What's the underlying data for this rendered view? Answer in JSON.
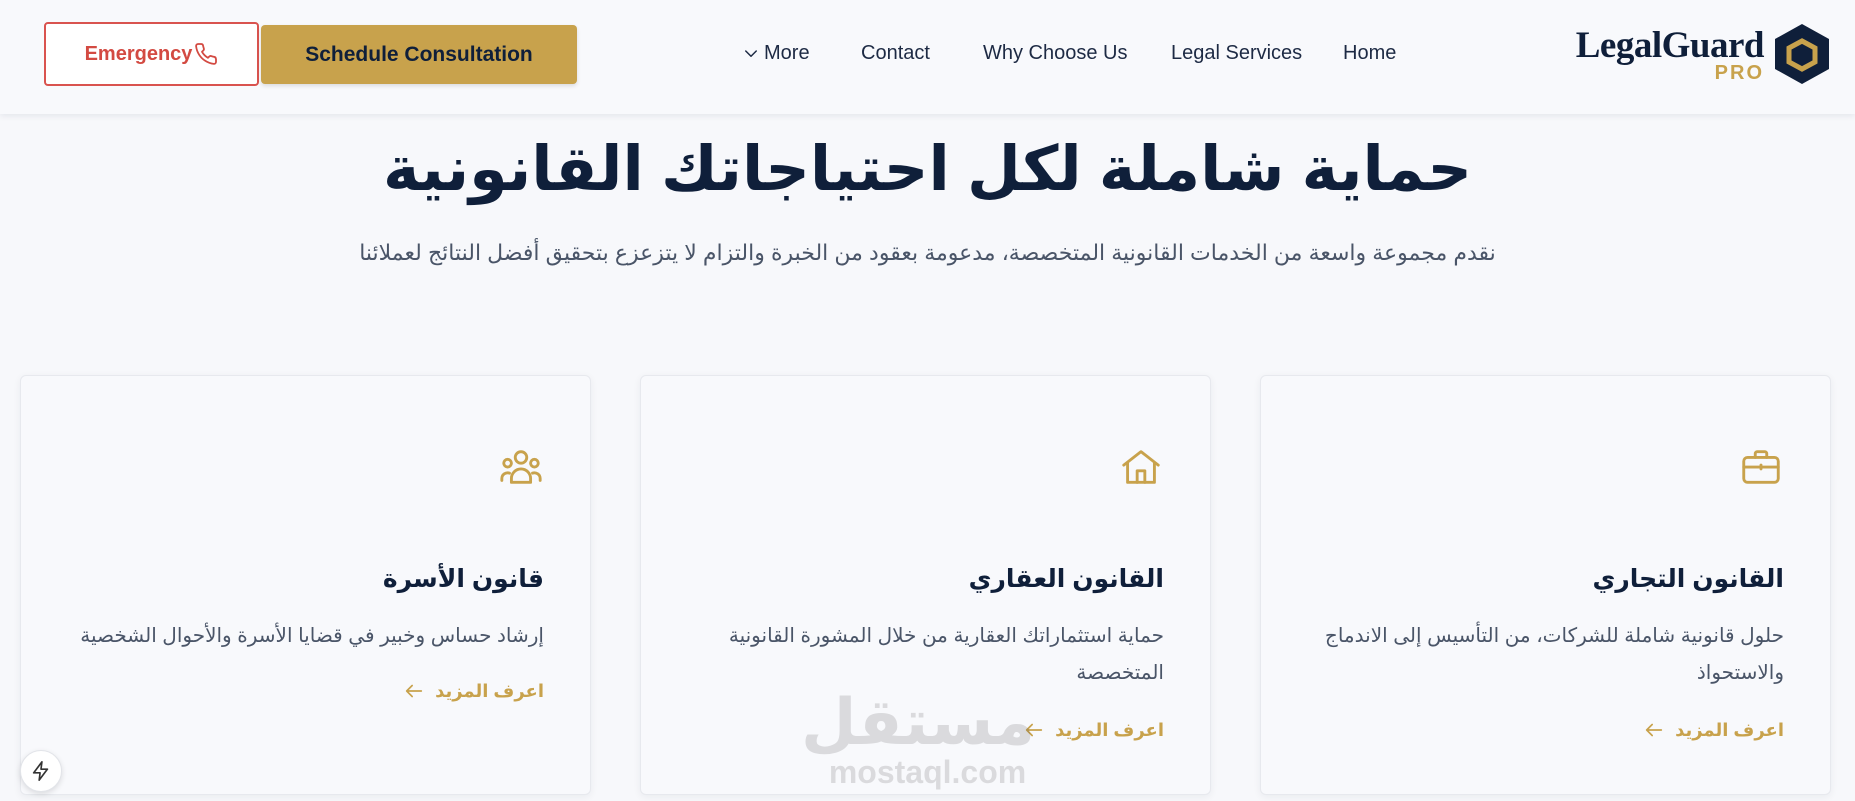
{
  "header": {
    "emergency_label": "Emergency",
    "schedule_label": "Schedule Consultation",
    "nav": {
      "more": "More",
      "contact": "Contact",
      "why": "Why Choose Us",
      "services": "Legal Services",
      "home": "Home"
    },
    "logo": {
      "name": "LegalGuard",
      "sub": "PRO"
    }
  },
  "hero": {
    "title": "حماية شاملة لكل احتياجاتك القانونية",
    "subtitle": "نقدم مجموعة واسعة من الخدمات القانونية المتخصصة، مدعومة بعقود من الخبرة والتزام لا يتزعزع بتحقيق أفضل النتائج لعملائنا"
  },
  "cards": [
    {
      "icon": "briefcase-icon",
      "title": "القانون التجاري",
      "desc": "حلول قانونية شاملة للشركات، من التأسيس إلى الاندماج والاستحواذ",
      "link": "اعرف المزيد"
    },
    {
      "icon": "home-icon",
      "title": "القانون العقاري",
      "desc": "حماية استثماراتك العقارية من خلال المشورة القانونية المتخصصة",
      "link": "اعرف المزيد"
    },
    {
      "icon": "users-icon",
      "title": "قانون الأسرة",
      "desc": "إرشاد حساس وخبير في قضايا الأسرة والأحوال الشخصية",
      "link": "اعرف المزيد"
    }
  ],
  "watermark": {
    "arabic": "مستقل",
    "latin": "mostaql.com"
  },
  "colors": {
    "navy": "#0f1f3a",
    "gold": "#c8a24c",
    "emergency_red": "#d34a42",
    "background": "#f7f8fb"
  }
}
